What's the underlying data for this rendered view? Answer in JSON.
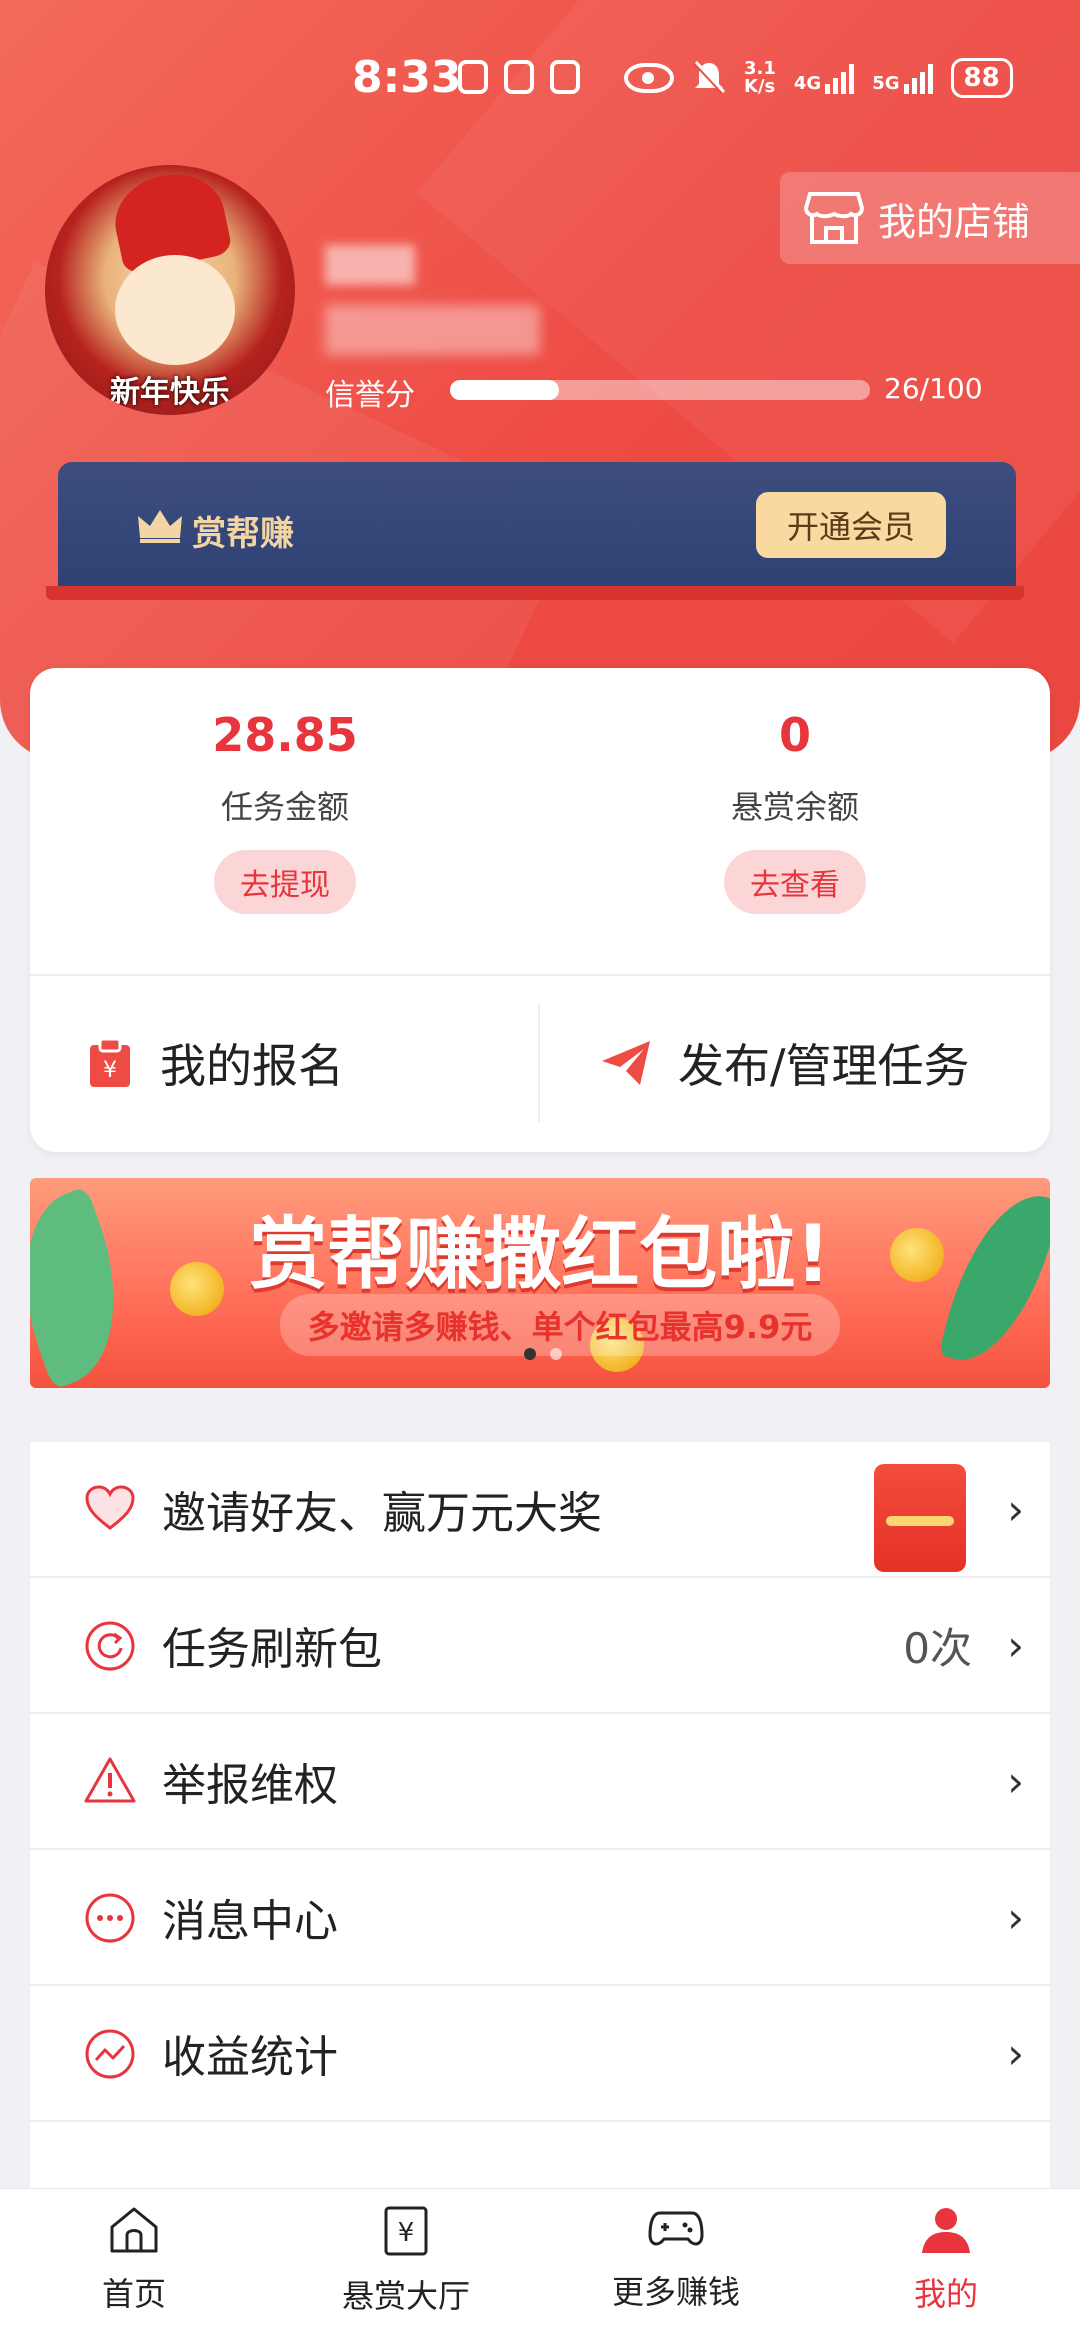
{
  "status_bar": {
    "time": "8:33",
    "net_speed_top": "3.1",
    "net_speed_unit": "K/s",
    "net1": "4G",
    "net2": "5G",
    "battery": "88"
  },
  "header": {
    "shop_button": "我的店铺",
    "avatar_caption": "新年快乐",
    "credit_label": "信誉分",
    "credit_progress": 0.26,
    "credit_value": "26/100"
  },
  "vip": {
    "title": "赏帮赚",
    "button": "开通会员"
  },
  "wallet": {
    "task_amount": "28.85",
    "task_amount_label": "任务金额",
    "withdraw_button": "去提现",
    "reward_balance": "0",
    "reward_balance_label": "悬赏余额",
    "view_button": "去查看",
    "my_signups": "我的报名",
    "publish_tasks": "发布/管理任务"
  },
  "promo": {
    "title": "赏帮赚撒红包啦!",
    "subtitle": "多邀请多赚钱、单个红包最高9.9元"
  },
  "menu": {
    "items": [
      {
        "label": "邀请好友、赢万元大奖",
        "extra": ""
      },
      {
        "label": "任务刷新包",
        "extra": "0次"
      },
      {
        "label": "举报维权",
        "extra": ""
      },
      {
        "label": "消息中心",
        "extra": ""
      },
      {
        "label": "收益统计",
        "extra": ""
      }
    ],
    "chevron": "›"
  },
  "nav": {
    "items": [
      {
        "label": "首页"
      },
      {
        "label": "悬赏大厅"
      },
      {
        "label": "更多赚钱"
      },
      {
        "label": "我的"
      }
    ]
  },
  "colors": {
    "accent": "#e8343c",
    "header_red": "#ee4b44",
    "vip_navy": "#33457a",
    "vip_gold": "#f9d99f"
  }
}
